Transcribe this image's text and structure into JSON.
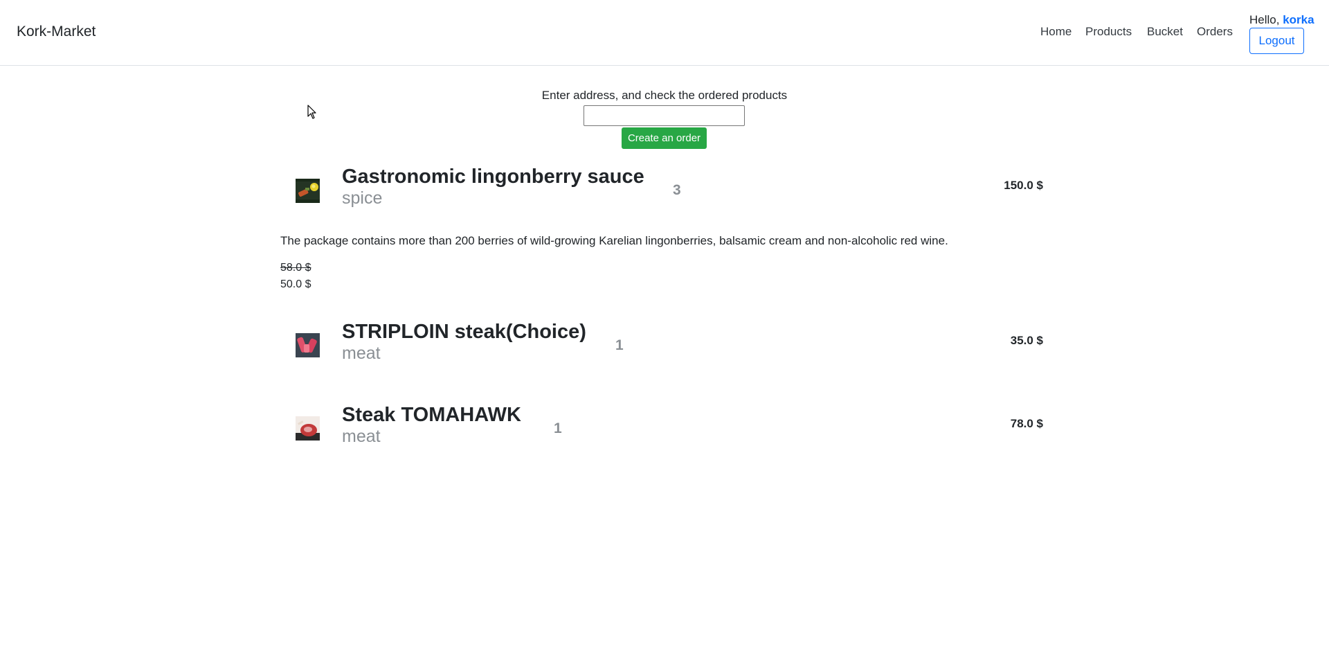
{
  "navbar": {
    "brand": "Kork-Market",
    "links": [
      "Home",
      "Products",
      "Bucket",
      "Orders"
    ],
    "greeting": "Hello, ",
    "username": "korka",
    "logout_label": "Logout"
  },
  "order_form": {
    "prompt": "Enter address, and check the ordered products",
    "address_value": "",
    "submit_label": "Create an order"
  },
  "items": [
    {
      "title": "Gastronomic lingonberry sauce",
      "category": "spice",
      "quantity": "3",
      "total": "150.0 $",
      "description": "The package contains more than 200 berries of wild-growing Karelian lingonberries, balsamic cream and non-alcoholic red wine.",
      "old_price": "58.0 $",
      "price": "50.0 $",
      "thumb_icon": "sauce-image"
    },
    {
      "title": "STRIPLOIN steak(Choice)",
      "category": "meat",
      "quantity": "1",
      "total": "35.0 $",
      "thumb_icon": "steak-image"
    },
    {
      "title": "Steak TOMAHAWK",
      "category": "meat",
      "quantity": "1",
      "total": "78.0 $",
      "thumb_icon": "tomahawk-image"
    }
  ],
  "colors": {
    "primary": "#0d6efd",
    "success": "#28a745",
    "muted": "#8a8f94"
  }
}
